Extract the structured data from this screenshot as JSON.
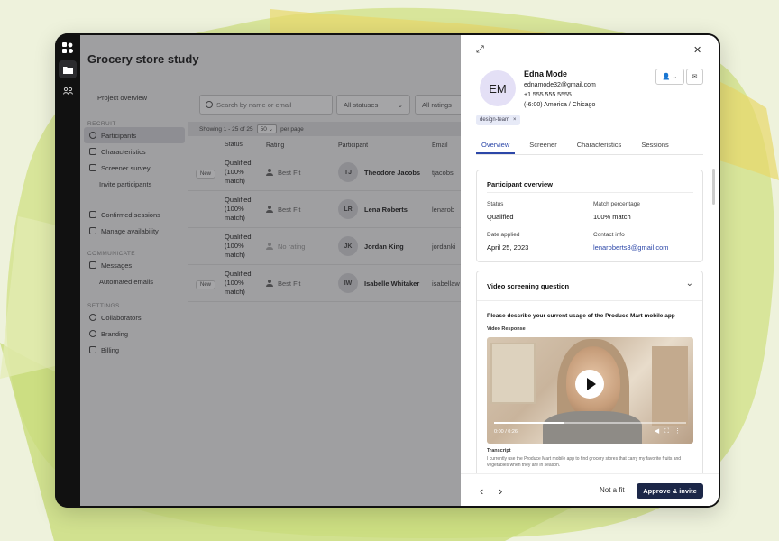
{
  "study_title": "Grocery store study",
  "nav": {
    "project_overview": "Project overview",
    "sections": [
      {
        "heading": "RECRUIT",
        "items": [
          {
            "label": "Participants",
            "icon": "people-icon",
            "active": true
          },
          {
            "label": "Characteristics",
            "icon": "list-icon"
          },
          {
            "label": "Screener survey",
            "icon": "survey-icon"
          },
          {
            "label": "Invite participants",
            "icon": ""
          }
        ]
      },
      {
        "heading": "",
        "items": [
          {
            "label": "Confirmed sessions",
            "icon": "calendar-check-icon"
          },
          {
            "label": "Manage availability",
            "icon": "calendar-icon"
          }
        ]
      },
      {
        "heading": "COMMUNICATE",
        "items": [
          {
            "label": "Messages",
            "icon": "mail-icon"
          },
          {
            "label": "Automated emails",
            "icon": ""
          }
        ]
      },
      {
        "heading": "SETTINGS",
        "items": [
          {
            "label": "Collaborators",
            "icon": "collaborators-icon"
          },
          {
            "label": "Branding",
            "icon": "palette-icon"
          },
          {
            "label": "Billing",
            "icon": "card-icon"
          }
        ]
      }
    ]
  },
  "toolbar": {
    "search_placeholder": "Search by name or email",
    "status_filter": "All statuses",
    "rating_filter": "All ratings"
  },
  "table": {
    "pagination_text": "Showing 1 - 25 of 25",
    "per_page_value": "50",
    "per_page_label": "per page",
    "headers": {
      "status": "Status",
      "rating": "Rating",
      "participant": "Participant",
      "email": "Email"
    },
    "rows": [
      {
        "new": "New",
        "status": "Qualified (100% match)",
        "rating": "Best Fit",
        "initials": "TJ",
        "name": "Theodore Jacobs",
        "email": "tjacobs"
      },
      {
        "new": "",
        "status": "Qualified (100% match)",
        "rating": "Best Fit",
        "initials": "LR",
        "name": "Lena Roberts",
        "email": "lenarob"
      },
      {
        "new": "",
        "status": "Qualified (100% match)",
        "rating": "No rating",
        "initials": "JK",
        "name": "Jordan King",
        "email": "jordanki"
      },
      {
        "new": "New",
        "status": "Qualified (100% match)",
        "rating": "Best Fit",
        "initials": "IW",
        "name": "Isabelle Whitaker",
        "email": "isabellaw"
      }
    ]
  },
  "drawer": {
    "initials": "EM",
    "name": "Edna Mode",
    "email": "ednamode32@gmail.com",
    "phone": "+1 555 555 5555",
    "timezone": "(-6:00) America / Chicago",
    "tag": "design-team",
    "tabs": [
      "Overview",
      "Screener",
      "Characteristics",
      "Sessions"
    ],
    "overview": {
      "title": "Participant overview",
      "status_label": "Status",
      "status_value": "Qualified",
      "match_label": "Match percentage",
      "match_value": "100% match",
      "date_label": "Date applied",
      "date_value": "April 25, 2023",
      "contact_label": "Contact info",
      "contact_value": "lenaroberts3@gmail.com"
    },
    "video": {
      "title": "Video screening question",
      "question": "Please describe your current usage of the Produce Mart mobile app",
      "response_label": "Video Response",
      "time": "0:00 / 0:26",
      "progress": 0.36,
      "transcript_label": "Transcript",
      "transcript": "I currently use the Produce Mart mobile app to find grocery stores that carry my favorite fruits and vegetables when they are in season."
    },
    "footer": {
      "not_fit": "Not a fit",
      "approve": "Approve & invite"
    }
  },
  "colors": {
    "accent": "#2c47a8",
    "primary_button": "#1c2748",
    "avatar_bg": "#e4e0f6"
  }
}
